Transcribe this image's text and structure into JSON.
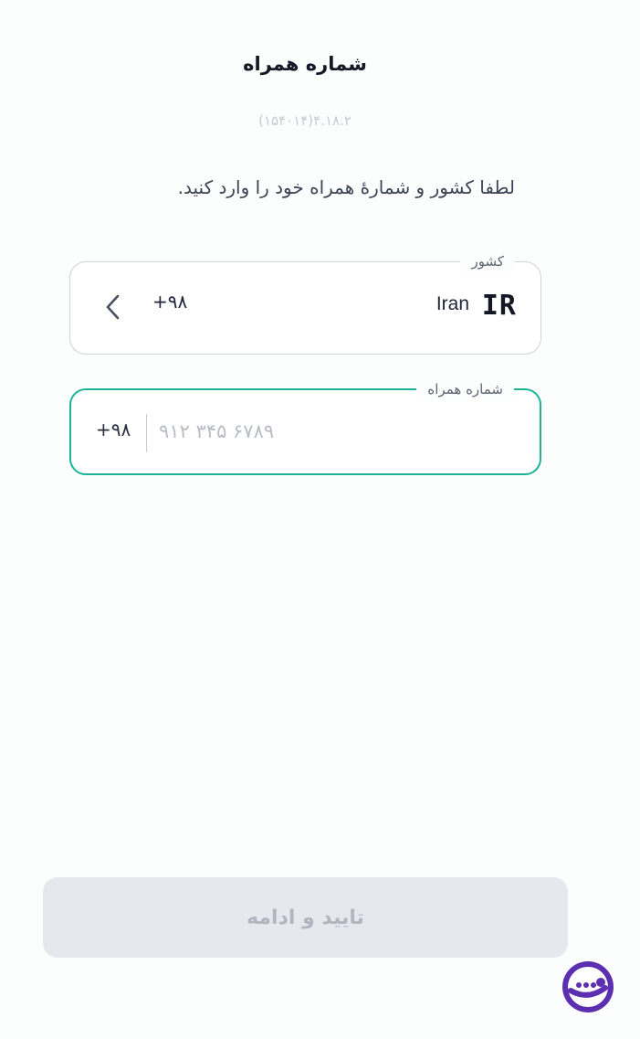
{
  "header": {
    "title": "شماره همراه",
    "version": "۴.۱۸.۲(۱۵۴۰۱۴)"
  },
  "instruction": "لطفا کشور و شمارهٔ همراه خود را وارد کنید.",
  "country_field": {
    "legend": "کشور",
    "country_name": "Iran",
    "country_iso": "IR",
    "dial_code": "+۹۸",
    "icon": "chevron-left-icon"
  },
  "phone_field": {
    "legend": "شماره همراه",
    "prefix": "+۹۸",
    "value": "",
    "placeholder": "۹۱۲ ۳۴۵ ۶۷۸۹",
    "focused": true
  },
  "confirm_button": {
    "label": "تایید و ادامه",
    "enabled": false
  },
  "watermark": {
    "icon": "brand-logo-icon"
  },
  "colors": {
    "accent": "#1db396",
    "disabled_bg": "#e7e8ed",
    "disabled_text": "#b3b6c1",
    "logo": "#5b2fb0"
  }
}
